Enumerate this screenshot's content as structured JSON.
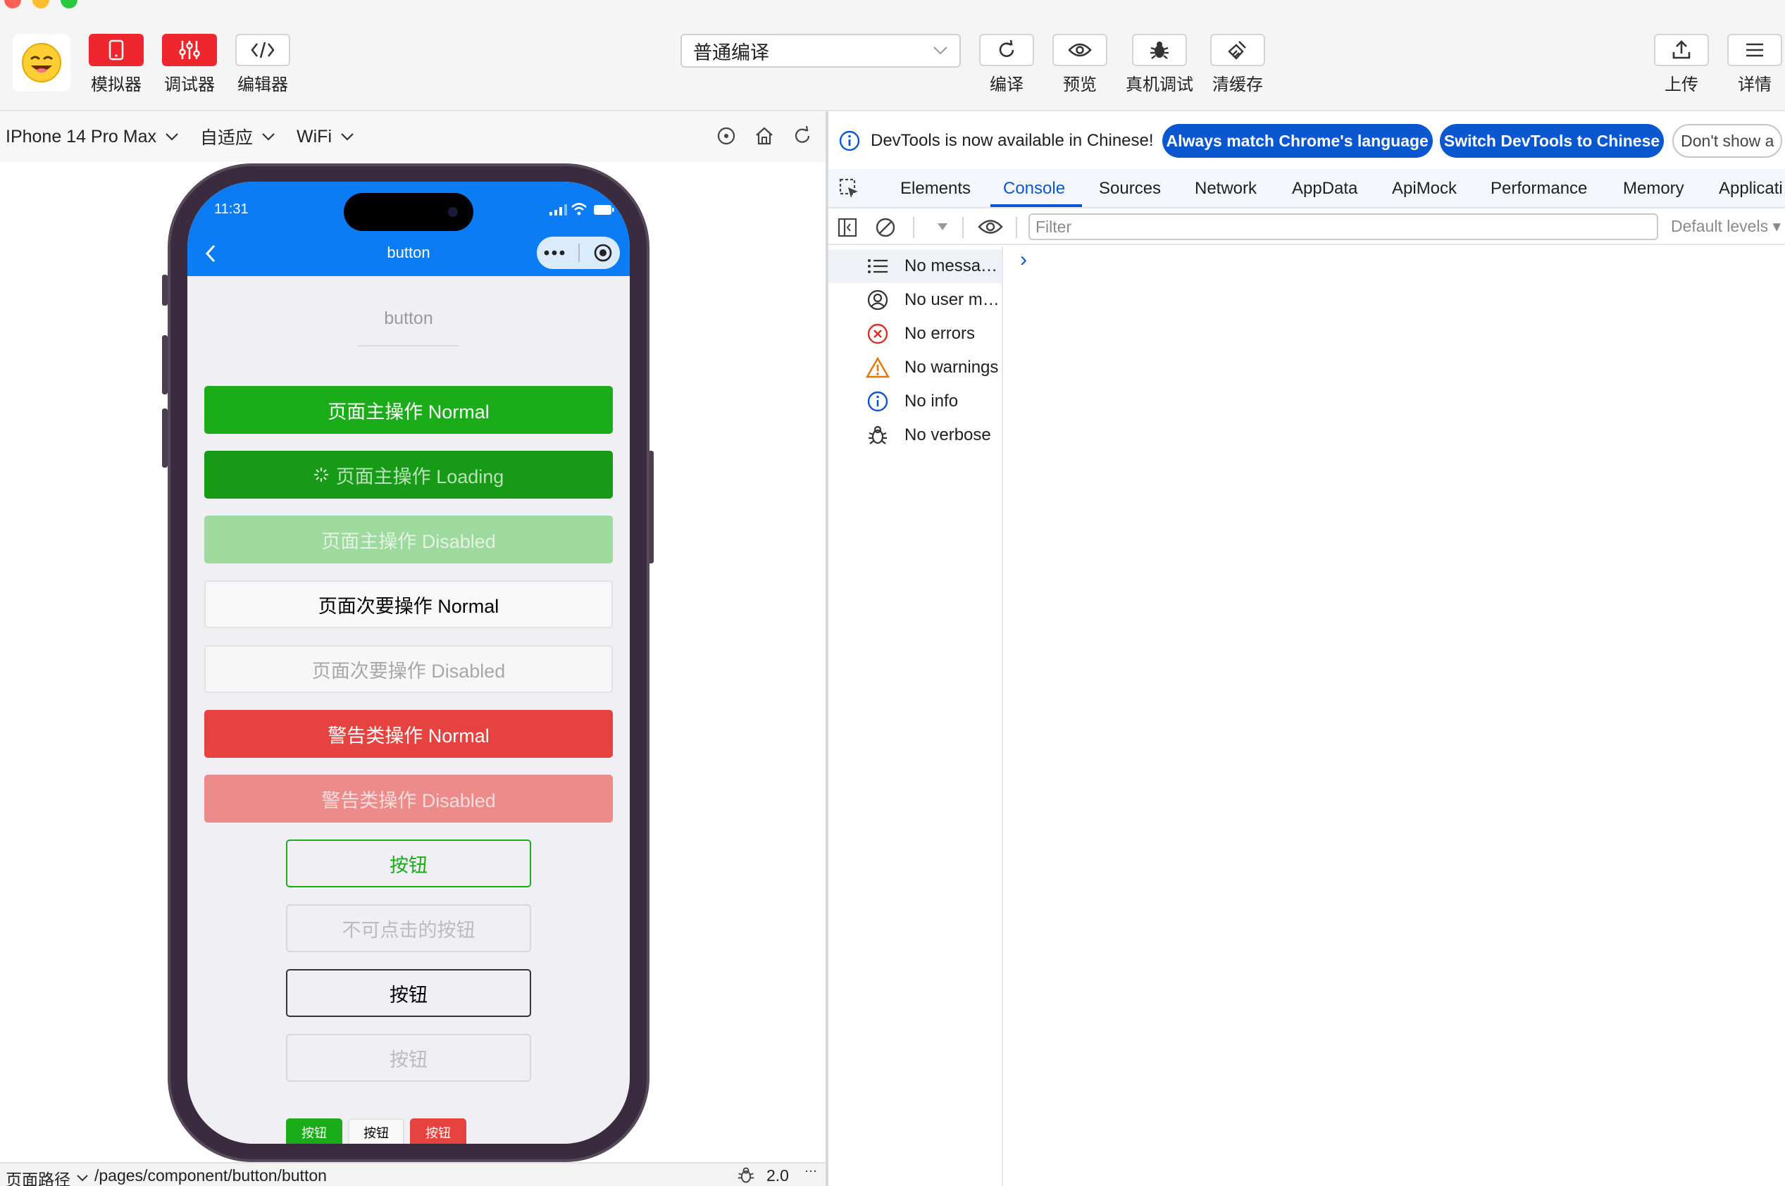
{
  "toolbar": {
    "simulator_label": "模拟器",
    "debugger_label": "调试器",
    "editor_label": "编辑器",
    "compile_mode": "普通编译",
    "compile_label": "编译",
    "preview_label": "预览",
    "device_debug_label": "真机调试",
    "clear_cache_label": "清缓存",
    "upload_label": "上传",
    "details_label": "详情"
  },
  "device_bar": {
    "device": "IPhone 14 Pro Max",
    "zoom": "自适应",
    "network": "WiFi"
  },
  "phone": {
    "time": "11:31",
    "nav_title": "button",
    "page_heading": "button",
    "buttons": [
      {
        "label": "页面主操作 Normal"
      },
      {
        "label": "页面主操作 Loading"
      },
      {
        "label": "页面主操作 Disabled"
      },
      {
        "label": "页面次要操作 Normal"
      },
      {
        "label": "页面次要操作 Disabled"
      },
      {
        "label": "警告类操作 Normal"
      },
      {
        "label": "警告类操作 Disabled"
      },
      {
        "label": "按钮"
      },
      {
        "label": "不可点击的按钮"
      },
      {
        "label": "按钮"
      },
      {
        "label": "按钮"
      }
    ],
    "mini_buttons": [
      "按钮",
      "按钮",
      "按钮"
    ]
  },
  "bottom_bar": {
    "path_label": "页面路径",
    "path": "/pages/component/button/button",
    "version": "2.0",
    "more": "···"
  },
  "devtools": {
    "banner_text": "DevTools is now available in Chinese!",
    "match_language": "Always match Chrome's language",
    "switch_chinese": "Switch DevTools to Chinese",
    "dont_show": "Don't show a",
    "tabs": [
      "Elements",
      "Console",
      "Sources",
      "Network",
      "AppData",
      "ApiMock",
      "Performance",
      "Memory",
      "Applicati"
    ],
    "active_tab": "Console",
    "filter_placeholder": "Filter",
    "levels": "Default levels ▾",
    "sidebar": [
      {
        "label": "No messa…",
        "icon": "list-icon"
      },
      {
        "label": "No user m…",
        "icon": "user-icon"
      },
      {
        "label": "No errors",
        "icon": "error-icon"
      },
      {
        "label": "No warnings",
        "icon": "warning-icon"
      },
      {
        "label": "No info",
        "icon": "info-icon"
      },
      {
        "label": "No verbose",
        "icon": "bug-icon"
      }
    ],
    "prompt": "›"
  },
  "colors": {
    "wechat_green": "#1aad19",
    "wechat_red": "#e64340",
    "nav_blue": "#0b7cf4",
    "devtools_blue": "#0b57d0",
    "toolbar_red": "#f0262e"
  }
}
